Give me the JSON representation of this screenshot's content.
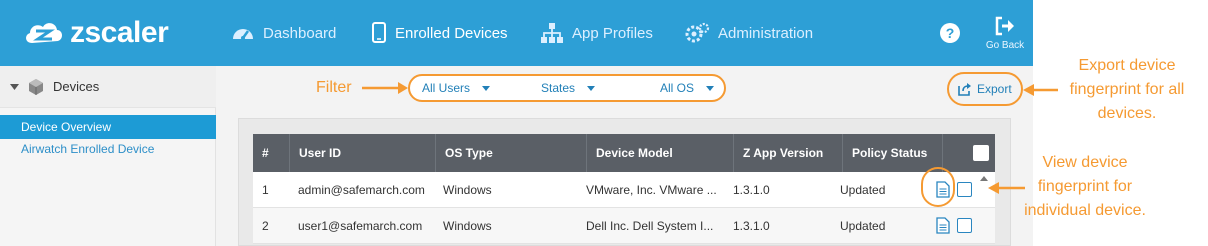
{
  "brand": {
    "name": "zscaler"
  },
  "nav": {
    "items": [
      {
        "label": "Dashboard",
        "icon": "dashboard-gauge-icon",
        "active": false
      },
      {
        "label": "Enrolled Devices",
        "icon": "mobile-device-icon",
        "active": true
      },
      {
        "label": "App Profiles",
        "icon": "hierarchy-icon",
        "active": false
      },
      {
        "label": "Administration",
        "icon": "gears-icon",
        "active": false
      }
    ],
    "help_icon": "question-circle-icon",
    "go_back_label": "Go Back"
  },
  "sidebar": {
    "section_title": "Devices",
    "items": [
      {
        "label": "Device Overview",
        "active": true
      },
      {
        "label": "Airwatch Enrolled Device",
        "active": false
      }
    ]
  },
  "toolbar": {
    "filters": [
      "All Users",
      "States",
      "All OS"
    ],
    "export_label": "Export"
  },
  "table": {
    "columns": [
      "#",
      "User ID",
      "OS Type",
      "Device Model",
      "Z App Version",
      "Policy Status"
    ],
    "rows": [
      {
        "num": "1",
        "user": "admin@safemarch.com",
        "os": "Windows",
        "model": "VMware, Inc. VMware ...",
        "version": "1.3.1.0",
        "status": "Updated"
      },
      {
        "num": "2",
        "user": "user1@safemarch.com",
        "os": "Windows",
        "model": "Dell Inc. Dell System I...",
        "version": "1.3.1.0",
        "status": "Updated"
      }
    ]
  },
  "annotations": {
    "filter": "Filter",
    "export": [
      "Export device",
      "fingerprint for all",
      "devices."
    ],
    "view": [
      "View device",
      "fingerprint for",
      "individual device."
    ]
  },
  "colors": {
    "topbar": "#2d9fd6",
    "accent": "#1d9bd5",
    "annotation": "#f59a32",
    "table_header": "#5a5f66"
  }
}
